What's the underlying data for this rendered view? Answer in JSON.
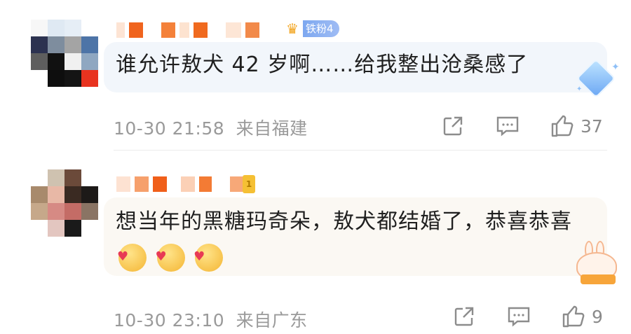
{
  "comments": [
    {
      "badge": {
        "label": "铁粉4"
      },
      "text": "谁允许敖犬 42 岁啊……给我整出沧桑感了",
      "time": "10-30 21:58",
      "location": "来自福建",
      "likes": "37",
      "colors": {
        "bubble": "#f2f6fb"
      }
    },
    {
      "fan_badge": "1",
      "text": "想当年的黑糖玛奇朵，敖犬都结婚了，恭喜恭喜",
      "time": "10-30 23:10",
      "location": "来自广东",
      "likes": "9",
      "emoji": [
        "hug-heart-emoji",
        "hug-heart-emoji",
        "hug-heart-emoji"
      ],
      "colors": {
        "bubble": "#fbf8f3"
      }
    }
  ],
  "icons": {
    "share": "share-icon",
    "comment": "comment-icon",
    "like": "thumbs-up-icon"
  }
}
